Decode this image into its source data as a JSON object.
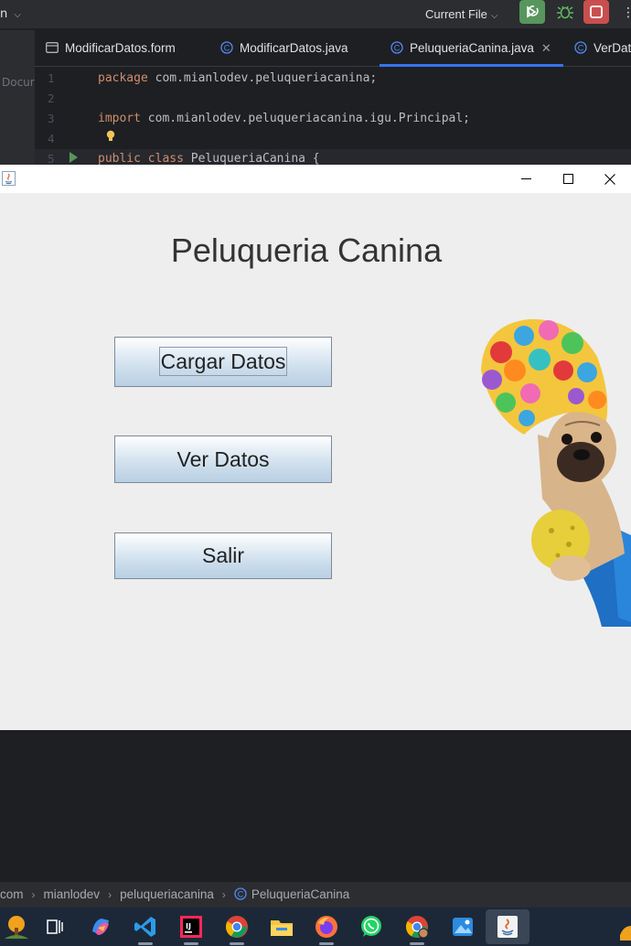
{
  "ide": {
    "menu_fragment": "n",
    "run_config": "Current File",
    "tabs": [
      {
        "label": "ModificarDatos.form",
        "kind": "form"
      },
      {
        "label": "ModificarDatos.java",
        "kind": "class"
      },
      {
        "label": "PeluqueriaCanina.java",
        "kind": "class",
        "active": true
      },
      {
        "label": "VerDat",
        "kind": "class"
      }
    ],
    "side_label": "Docur",
    "code": [
      {
        "n": "1",
        "kw": "package",
        "rest": " com.mianlodev.peluqueriacanina;"
      },
      {
        "n": "2",
        "kw": "",
        "rest": ""
      },
      {
        "n": "3",
        "kw": "import",
        "rest": " com.mianlodev.peluqueriacanina.igu.Principal;"
      },
      {
        "n": "4",
        "kw": "",
        "rest": ""
      },
      {
        "n": "5",
        "kw": "public class",
        "rest": " PeluqueriaCanina {"
      }
    ],
    "breadcrumb": [
      "com",
      "mianlodev",
      "peluqueriacanina",
      "PeluqueriaCanina"
    ]
  },
  "window": {
    "minimize_glyph": "–",
    "close_glyph": "✕"
  },
  "app": {
    "title": "Peluqueria Canina",
    "buttons": {
      "cargar": "Cargar Datos",
      "ver": "Ver Datos",
      "salir": "Salir"
    },
    "image": "pug-with-flower-bath-cap"
  },
  "taskbar": {
    "apps": [
      "widgets",
      "task-view",
      "copilot",
      "vscode",
      "intellij",
      "chrome",
      "file-explorer",
      "firefox",
      "whatsapp",
      "chrome-profile",
      "photos",
      "java"
    ]
  },
  "colors": {
    "ide_bg": "#1e1f22",
    "accent_tab": "#3574f0",
    "swing_bg": "#eeeeee",
    "keyword": "#cf8e6d"
  }
}
